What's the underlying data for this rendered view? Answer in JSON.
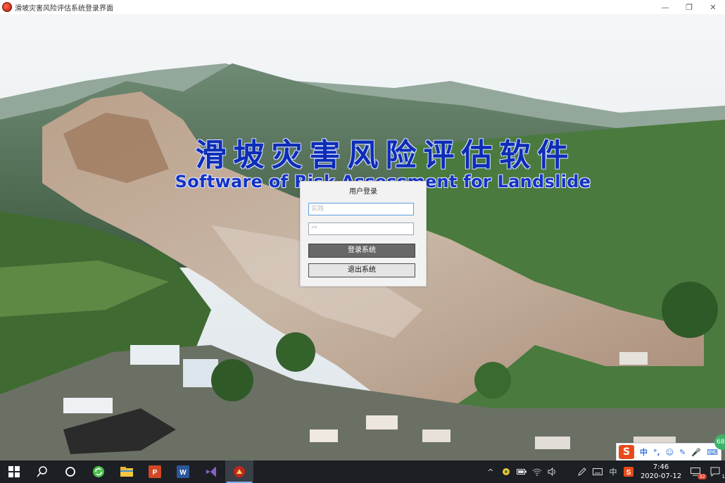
{
  "window": {
    "title": "滑坡灾害风险评估系统登录界面",
    "minimize_glyph": "—",
    "maximize_glyph": "❐",
    "close_glyph": "✕"
  },
  "banner": {
    "title_cn": "滑坡灾害风险评估软件",
    "title_en": "Software of Risk Assessment for Landslide"
  },
  "login": {
    "title": "用户登录",
    "username_placeholder": "实践",
    "password_value": "**",
    "login_button": "登录系统",
    "exit_button": "退出系统"
  },
  "ime": {
    "logo": "S",
    "items": [
      "中",
      "°,",
      "☺",
      "✎",
      "🎤",
      "⌨"
    ],
    "badge": "68"
  },
  "taskbar": {
    "apps": [
      "windows-start",
      "search",
      "cortana",
      "sync-app",
      "file-explorer",
      "powerpoint",
      "word",
      "visual-studio",
      "landslide-app"
    ],
    "tray": {
      "chevron": "^",
      "input_mode": "中",
      "time": "7:46",
      "date": "2020-07-12",
      "notification_count": "32",
      "action_center_count": "1"
    }
  }
}
